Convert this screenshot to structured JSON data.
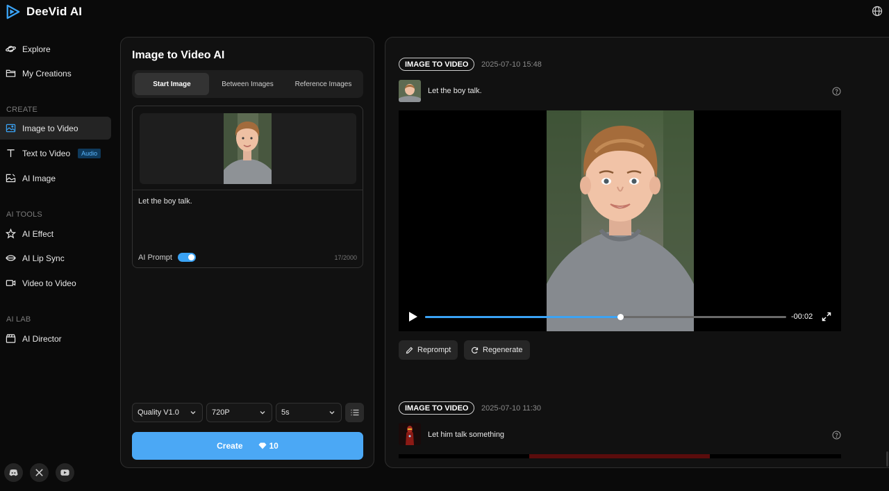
{
  "app": {
    "name": "DeeVid AI"
  },
  "sidebar": {
    "items": [
      {
        "label": "Explore",
        "icon": "planet-icon"
      },
      {
        "label": "My Creations",
        "icon": "folder-icon"
      },
      {
        "label": "Image to Video",
        "icon": "image-icon"
      },
      {
        "label": "Text to Video",
        "icon": "text-icon",
        "badge": "Audio"
      },
      {
        "label": "AI Image",
        "icon": "image-edit-icon"
      },
      {
        "label": "AI Effect",
        "icon": "sparkle-icon"
      },
      {
        "label": "AI Lip Sync",
        "icon": "lips-icon"
      },
      {
        "label": "Video to Video",
        "icon": "video-camera-icon"
      },
      {
        "label": "AI Director",
        "icon": "clapper-icon"
      }
    ],
    "sections": [
      "CREATE",
      "AI TOOLS",
      "AI LAB"
    ],
    "socials": [
      "discord-icon",
      "x-icon",
      "youtube-icon"
    ]
  },
  "editor": {
    "title": "Image to Video AI",
    "tabs": [
      "Start Image",
      "Between Images",
      "Reference Images"
    ],
    "active_tab": "Start Image",
    "prompt": "Let the boy talk.",
    "ai_prompt_label": "AI Prompt",
    "ai_prompt_on": true,
    "char_count": "17/2000",
    "quality": "Quality V1.0",
    "resolution": "720P",
    "duration": "5s",
    "create_label": "Create",
    "credits": "10"
  },
  "history": [
    {
      "type": "IMAGE TO VIDEO",
      "timestamp": "2025-07-10 15:48",
      "prompt": "Let the boy talk.",
      "player": {
        "time": "-00:02",
        "progress_percent": 54
      },
      "actions": [
        "Reprompt",
        "Regenerate"
      ]
    },
    {
      "type": "IMAGE TO VIDEO",
      "timestamp": "2025-07-10 11:30",
      "prompt": "Let him talk something"
    }
  ],
  "colors": {
    "accent": "#4ba8f5",
    "background": "#0a0a0a",
    "panel": "#111111"
  }
}
